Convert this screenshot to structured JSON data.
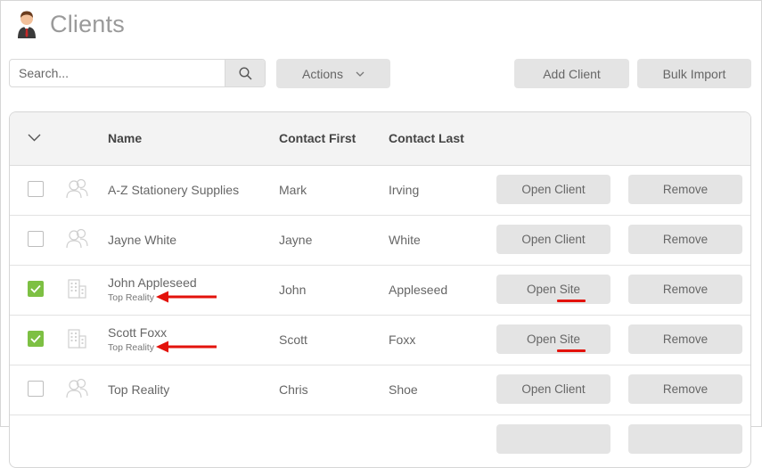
{
  "page": {
    "title": "Clients",
    "icon": "business-person-icon"
  },
  "toolbar": {
    "search_placeholder": "Search...",
    "search_icon": "search-icon",
    "actions_label": "Actions",
    "add_client_label": "Add Client",
    "bulk_import_label": "Bulk Import"
  },
  "table": {
    "columns": {
      "name": "Name",
      "contact_first": "Contact First",
      "contact_last": "Contact Last"
    },
    "rows": [
      {
        "checked": false,
        "icon": "people-group-icon",
        "name": "A-Z Stationery Supplies",
        "sub": "",
        "contact_first": "Mark",
        "contact_last": "Irving",
        "open_label": "Open Client",
        "remove_label": "Remove"
      },
      {
        "checked": false,
        "icon": "people-group-icon",
        "name": "Jayne White",
        "sub": "",
        "contact_first": "Jayne",
        "contact_last": "White",
        "open_label": "Open Client",
        "remove_label": "Remove"
      },
      {
        "checked": true,
        "icon": "building-icon",
        "name": "John Appleseed",
        "sub": "Top Reality",
        "contact_first": "John",
        "contact_last": "Appleseed",
        "open_label": "Open Site",
        "remove_label": "Remove"
      },
      {
        "checked": true,
        "icon": "building-icon",
        "name": "Scott Foxx",
        "sub": "Top Reality",
        "contact_first": "Scott",
        "contact_last": "Foxx",
        "open_label": "Open Site",
        "remove_label": "Remove"
      },
      {
        "checked": false,
        "icon": "people-group-icon",
        "name": "Top Reality",
        "sub": "",
        "contact_first": "Chris",
        "contact_last": "Shoe",
        "open_label": "Open Client",
        "remove_label": "Remove"
      }
    ]
  },
  "colors": {
    "accent_check": "#7dc043",
    "annotation": "#e3120b",
    "button_bg": "#e4e4e4"
  }
}
